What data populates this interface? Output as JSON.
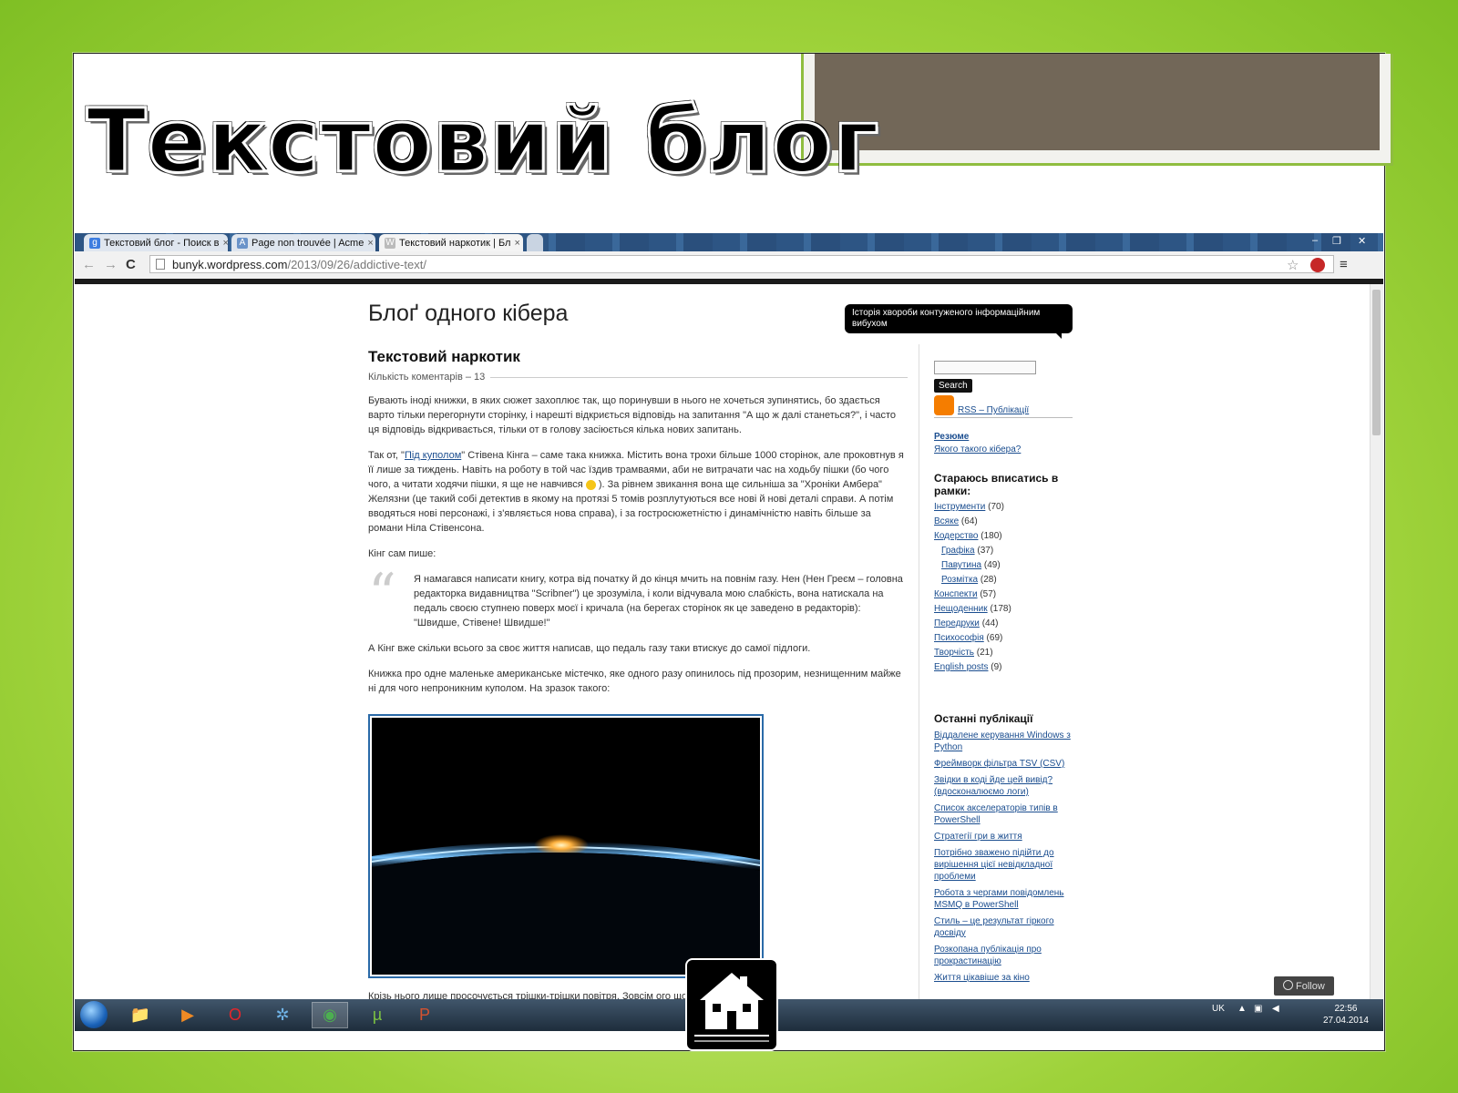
{
  "slide": {
    "title": "Текстовий блог"
  },
  "browser": {
    "tabs": [
      {
        "label": "Текстовий блог - Поиск в",
        "icon": "google-icon",
        "close": "×"
      },
      {
        "label": "Page non trouvée | Acme",
        "icon": "acme-icon",
        "close": "×"
      },
      {
        "label": "Текстовий наркотик | Бл",
        "icon": "wordpress-icon",
        "close": "×"
      }
    ],
    "window_controls": {
      "minimize": "‒",
      "restore": "❐",
      "close": "✕"
    },
    "nav": {
      "back": "←",
      "forward": "→",
      "reload": "C"
    },
    "url": {
      "host": "bunyk.wordpress.com",
      "path": "/2013/09/26/addictive-text/"
    }
  },
  "blog": {
    "title": "Блоґ одного кібера",
    "tagline": "Історія хвороби контуженого інформаційним вибухом"
  },
  "post": {
    "title": "Текстовий наркотик",
    "comments": "Кількість коментарів – 13",
    "p1": "Бувають іноді книжки, в яких сюжет захоплює так, що поринувши в нього не хочеться зупинятись, бо здається варто тільки перегорнути сторінку, і нарешті відкриється відповідь на запитання \"А що ж далі станеться?\", і часто ця відповідь відкривається, тільки от в голову засіюється кілька нових запитань.",
    "p2_before": "Так от, \"",
    "p2_link": "Під куполом",
    "p2_after": "\" Стівена Кінга – саме така книжка. Містить вона трохи більше 1000 сторінок, але проковтнув я її лише за тиждень. Навіть на роботу в той час їздив трамваями, аби не витрачати час на ходьбу пішки (бо чого чого, а читати ходячи пішки, я ще не навчився ",
    "p2_end": " ). За рівнем звикання вона ще сильніша за \"Хроніки Амбера\" Желязни (це такий собі детектив в якому на протязі 5 томів розплутуються все нові й нові деталі справи. А потім вводяться нові персонажі, і з'являється нова справа), і за гостросюжетністю і динамічністю навіть більше за романи Ніла Стівенсона.",
    "p3": "Кінг сам пише:",
    "quote": "Я намагався написати книгу, котра від початку й до кінця мчить на повнім газу. Нен (Нен Греєм – головна редакторка видавництва \"Scribner\") це зрозуміла, і коли відчувала мою слабкість, вона натискала на педаль своєю ступнею поверх моєї і кричала (на берегах сторінок як це заведено в редакторів): \"Швидше, Стівене! Швидше!\"",
    "quote_mark": "“",
    "p4": "А Кінг вже скільки всього за своє життя написав, що педаль газу таки втискує до самої підлоги.",
    "p5": "Книжка про одне маленьке американське містечко, яке одного разу опинилось під прозорим, незнищенним майже ні для чого непроникним куполом. На зразок такого:",
    "p6_cut": "Крізь нього лише просочується трішки-трішки повітря. Зовсім                                   ого щоб дихати, але ліси"
  },
  "sidebar": {
    "search_button": "Search",
    "rss": "RSS – Публікації",
    "resume": "Резюме",
    "about": "Якого такого кібера?",
    "categories_head": "Стараюсь вписатись в рамки:",
    "categories": [
      {
        "name": "Інструменти",
        "count": "(70)",
        "sub": false
      },
      {
        "name": "Всяке",
        "count": "(64)",
        "sub": false
      },
      {
        "name": "Кодерство",
        "count": "(180)",
        "sub": false
      },
      {
        "name": "Графіка",
        "count": "(37)",
        "sub": true
      },
      {
        "name": "Павутина",
        "count": "(49)",
        "sub": true
      },
      {
        "name": "Розмітка",
        "count": "(28)",
        "sub": true
      },
      {
        "name": "Конспекти",
        "count": "(57)",
        "sub": false
      },
      {
        "name": "Нещоденник",
        "count": "(178)",
        "sub": false
      },
      {
        "name": "Передруки",
        "count": "(44)",
        "sub": false
      },
      {
        "name": "Психософія",
        "count": "(69)",
        "sub": false
      },
      {
        "name": "Творчість",
        "count": "(21)",
        "sub": false
      },
      {
        "name": "English posts",
        "count": "(9)",
        "sub": false
      }
    ],
    "recent_head": "Останні публікації",
    "recent": [
      "Віддалене керування Windows з Python",
      "Фреймворк фільтра TSV (CSV)",
      "Звідки в коді йде цей вивід? (вдосконалюємо логи)",
      "Список акселераторів типів в PowerShell",
      "Стратегії гри в життя",
      "Потрібно зважено підійти до вирішення цієї невідкладної проблеми",
      "Робота з чергами повідомлень MSMQ в PowerShell",
      "Стиль – це результат гіркого досвіду",
      "Розкопана публікація про прокрастинацію",
      "Життя цікавіше за кіно"
    ],
    "follow": "Follow"
  },
  "taskbar": {
    "apps": [
      {
        "name": "explorer",
        "glyph": "📁"
      },
      {
        "name": "media-player",
        "glyph": "▶"
      },
      {
        "name": "opera",
        "glyph": "O"
      },
      {
        "name": "safari",
        "glyph": "✲"
      },
      {
        "name": "chrome",
        "glyph": "◉"
      },
      {
        "name": "utorrent",
        "glyph": "µ"
      },
      {
        "name": "powerpoint",
        "glyph": "P"
      }
    ],
    "lang": "UK",
    "time": "22:56",
    "date": "27.04.2014"
  },
  "colors": {
    "link": "#1a4d8f",
    "slide_bg": "#9ed23a",
    "tabstrip": "#2f5988",
    "deco": "#726758"
  }
}
